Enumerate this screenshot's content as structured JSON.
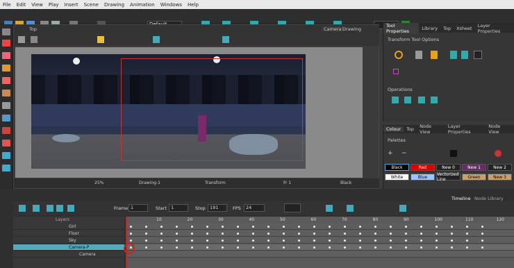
{
  "menu": [
    "File",
    "Edit",
    "View",
    "Play",
    "Insert",
    "Scene",
    "Drawing",
    "Animation",
    "Windows",
    "Help"
  ],
  "toolbar": {
    "workspace": "Default"
  },
  "viewport": {
    "title": "Top",
    "tab_camera": "Camera",
    "tab_drawing": "Drawing"
  },
  "status": {
    "zoom": "25%",
    "drawing": "Drawing-1",
    "tool": "Transform",
    "frame": "Fr 1",
    "bg": "Black"
  },
  "tool_panel": {
    "tabs": [
      "Tool Properties",
      "Library",
      "Top",
      "Xsheet",
      "Layer Properties"
    ],
    "section1": "Transform Tool Options",
    "section2": "Operations"
  },
  "colour_panel": {
    "tabs": [
      "Colour",
      "Top",
      "Node View",
      "Layer Properties",
      "Node View"
    ],
    "palettes_label": "Palettes",
    "swatches": [
      {
        "label": "Black",
        "color": "#000000",
        "text": "#ffffff"
      },
      {
        "label": "Red",
        "color": "#e00000",
        "text": "#ffffff"
      },
      {
        "label": "New 0",
        "color": "#222222",
        "text": "#ffffff"
      },
      {
        "label": "New 1",
        "color": "#6a2a6a",
        "text": "#ffffff"
      },
      {
        "label": "New 2",
        "color": "#222222",
        "text": "#ffffff"
      },
      {
        "label": "White",
        "color": "#ffffff",
        "text": "#000000"
      },
      {
        "label": "Blue",
        "color": "#9ec4ff",
        "text": "#000000"
      },
      {
        "label": "Vectorized Line",
        "color": "#222222",
        "text": "#ffffff"
      },
      {
        "label": "Green",
        "color": "#c8a070",
        "text": "#000000"
      },
      {
        "label": "New 3",
        "color": "#c8a070",
        "text": "#000000"
      }
    ]
  },
  "timeline": {
    "frame_label": "Frame",
    "frame_val": "1",
    "start_label": "Start",
    "start_val": "1",
    "stop_label": "Stop",
    "stop_val": "191",
    "fps_label": "FPS",
    "fps_val": "24",
    "tab1": "Timeline",
    "tab2": "Node Library",
    "layers_header": "Layers",
    "layers": [
      "Girl",
      "Floor",
      "Sky",
      "Camera-P",
      "Camera"
    ],
    "frame_ticks": [
      "10",
      "20",
      "30",
      "40",
      "50",
      "60",
      "70",
      "80",
      "90",
      "100",
      "110",
      "120"
    ]
  }
}
